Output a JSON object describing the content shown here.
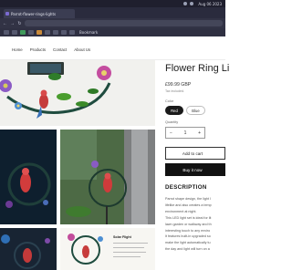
{
  "browser": {
    "tab_title": "Parrot-flower-rings-lights",
    "clock": "Aug 06 2023",
    "bookmark_label": "Bookmark"
  },
  "nav": {
    "home": "Home",
    "products": "Products",
    "contact": "Contact",
    "about": "About Us"
  },
  "gallery": {
    "info_card_title": "Solar Flight"
  },
  "product": {
    "title": "Flower Ring Li",
    "price": "£99.99 GBP",
    "tax_note": "Tax included.",
    "color_label": "Color",
    "colors": [
      "Red",
      "Blue"
    ],
    "selected_color": "Red",
    "quantity_label": "Quantity",
    "quantity": "1",
    "minus": "−",
    "plus": "+",
    "add_to_cart": "Add to cart",
    "buy_now": "Buy it now",
    "description_heading": "DESCRIPTION",
    "description_lines": [
      "Parrot shape design, the light l",
      "lifelike and also creates a temp",
      "environment at night.",
      "This LED light set is ideal for lit",
      "lawn garden or walkway and th",
      "interesting touch to any enviro",
      "It features built-in upgraded so",
      "make the light automatically tu",
      "the day and light will turn on a"
    ]
  }
}
